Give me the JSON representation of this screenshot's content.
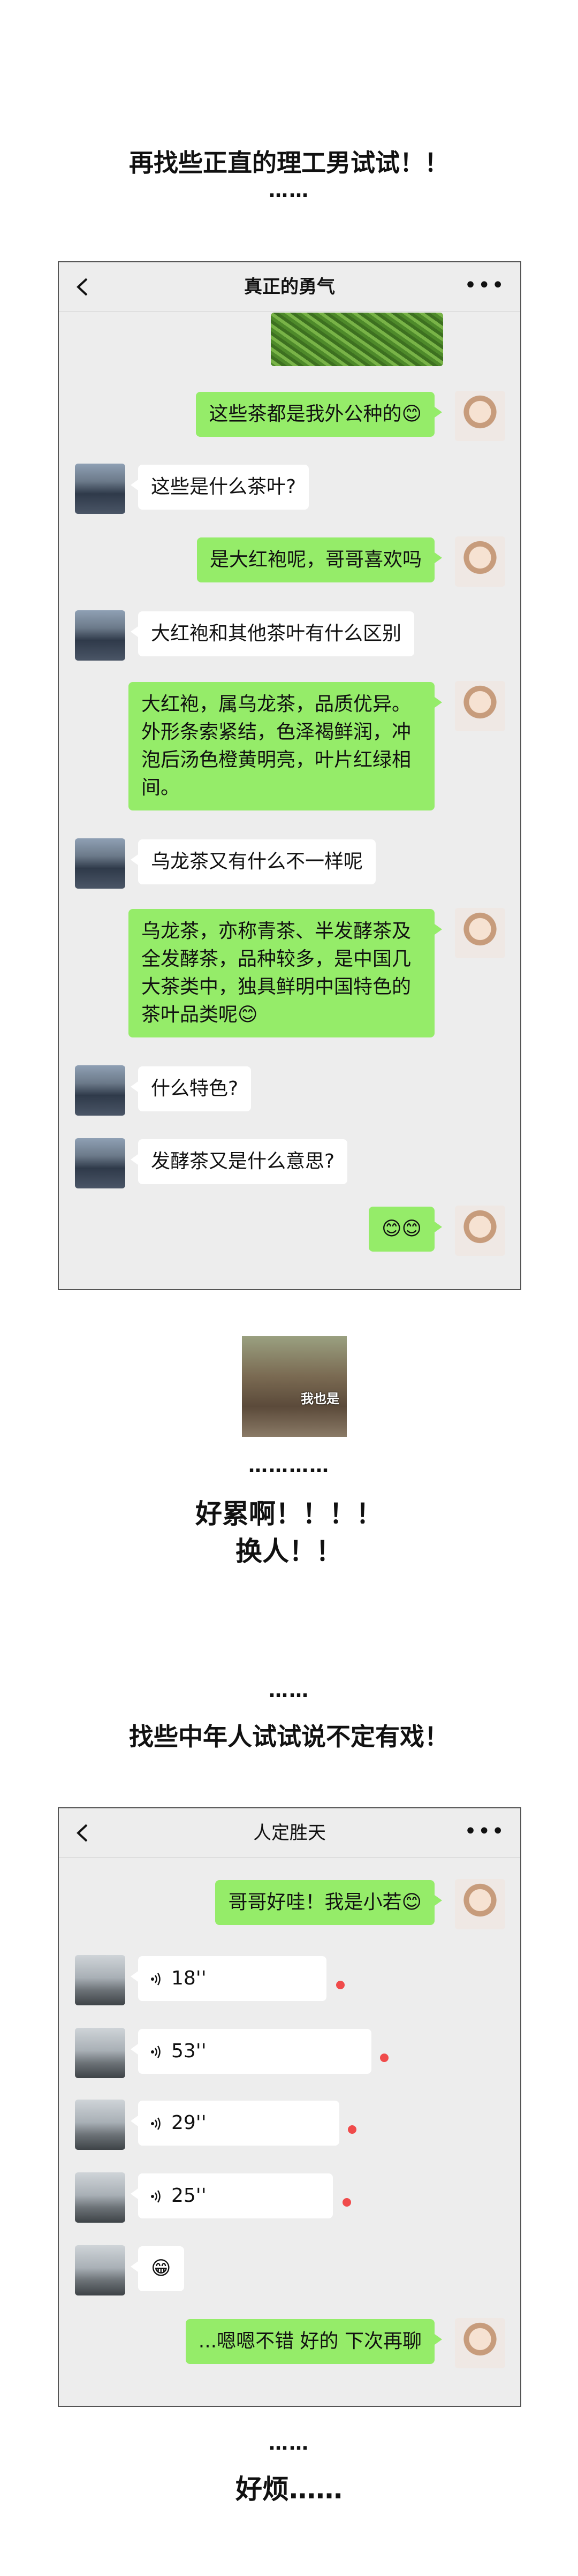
{
  "sections": {
    "heading1": "再找些正直的理工男试试！！",
    "dots1": "……",
    "dots_meme": "…………",
    "heading2_line1": "好累啊！！！！",
    "heading2_line2": "换人！！",
    "dots2": "……",
    "heading3": "找些中年人试试说不定有戏！",
    "dots3": "……",
    "heading4": "好烦……"
  },
  "meme": {
    "caption": "我也是"
  },
  "chat1": {
    "title": "真正的勇气",
    "more": "•••",
    "messages": [
      {
        "side": "right",
        "text": "这些茶都是我外公种的😊"
      },
      {
        "side": "left",
        "text": "这些是什么茶叶?"
      },
      {
        "side": "right",
        "text": "是大红袍呢，哥哥喜欢吗"
      },
      {
        "side": "left",
        "text": "大红袍和其他茶叶有什么区别"
      },
      {
        "side": "right",
        "text": "大红袍，属乌龙茶，品质优异。外形条索紧结，色泽褐鲜润，冲泡后汤色橙黄明亮，叶片红绿相间。"
      },
      {
        "side": "left",
        "text": "乌龙茶又有什么不一样呢"
      },
      {
        "side": "right",
        "text": "乌龙茶，亦称青茶、半发酵茶及全发酵茶，品种较多，是中国几大茶类中，独具鲜明中国特色的茶叶品类呢😊"
      },
      {
        "side": "left",
        "text": "什么特色?"
      },
      {
        "side": "left",
        "text": "发酵茶又是什么意思?"
      },
      {
        "side": "right",
        "text": "😊😊"
      }
    ]
  },
  "chat2": {
    "title": "人定胜天",
    "more": "•••",
    "messages": [
      {
        "side": "right",
        "text": "哥哥好哇！我是小若😊"
      },
      {
        "side": "left",
        "voice": "18''"
      },
      {
        "side": "left",
        "voice": "53''"
      },
      {
        "side": "left",
        "voice": "29''"
      },
      {
        "side": "left",
        "voice": "25''"
      },
      {
        "side": "left",
        "text": "😁"
      },
      {
        "side": "right",
        "text": "...嗯嗯不错 好的 下次再聊"
      }
    ]
  },
  "colors": {
    "green_bubble": "#95ec69",
    "white_bubble": "#ffffff",
    "chat_bg": "#ededed",
    "unread_dot": "#f04b4b"
  }
}
